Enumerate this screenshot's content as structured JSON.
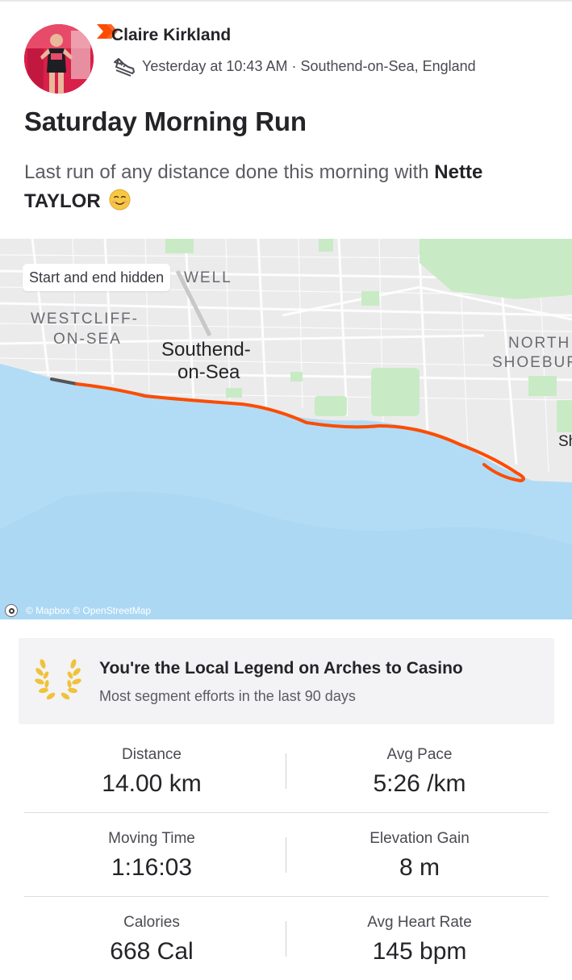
{
  "athlete": {
    "name": "Claire Kirkland"
  },
  "activity": {
    "timestamp": "Yesterday at 10:43 AM",
    "location": "Southend-on-Sea, England",
    "separator": "·",
    "title": "Saturday Morning Run",
    "description_text": "Last run of any distance done this morning with ",
    "description_tag": "Nette TAYLOR"
  },
  "map": {
    "privacy_label": "Start and end hidden",
    "places": {
      "westcliff_1": "WESTCLIFF-",
      "westcliff_2": "ON-SEA",
      "southend_1": "Southend-",
      "southend_2": "on-Sea",
      "north_1": "NORTH",
      "north_2": "SHOEBUR",
      "well": "WELL",
      "sh": "Sh"
    },
    "attribution": "© Mapbox © OpenStreetMap",
    "colors": {
      "land": "#ecebeb",
      "water": "#b2dcf6",
      "park": "#c8ebc6",
      "route": "#fc4c02",
      "route_hidden": "#555555"
    }
  },
  "legend": {
    "title": "You're the Local Legend on Arches to Casino",
    "subtitle": "Most segment efforts in the last 90 days",
    "icon": "laurel-icon"
  },
  "stats": [
    {
      "label": "Distance",
      "value": "14.00 km"
    },
    {
      "label": "Avg Pace",
      "value": "5:26 /km"
    },
    {
      "label": "Moving Time",
      "value": "1:16:03"
    },
    {
      "label": "Elevation Gain",
      "value": "8 m"
    },
    {
      "label": "Calories",
      "value": "668 Cal"
    },
    {
      "label": "Avg Heart Rate",
      "value": "145 bpm"
    }
  ],
  "colors": {
    "brand": "#fc4c02",
    "legend_gold": "#f0c23a",
    "text": "#242428",
    "muted": "#5b5b63"
  }
}
